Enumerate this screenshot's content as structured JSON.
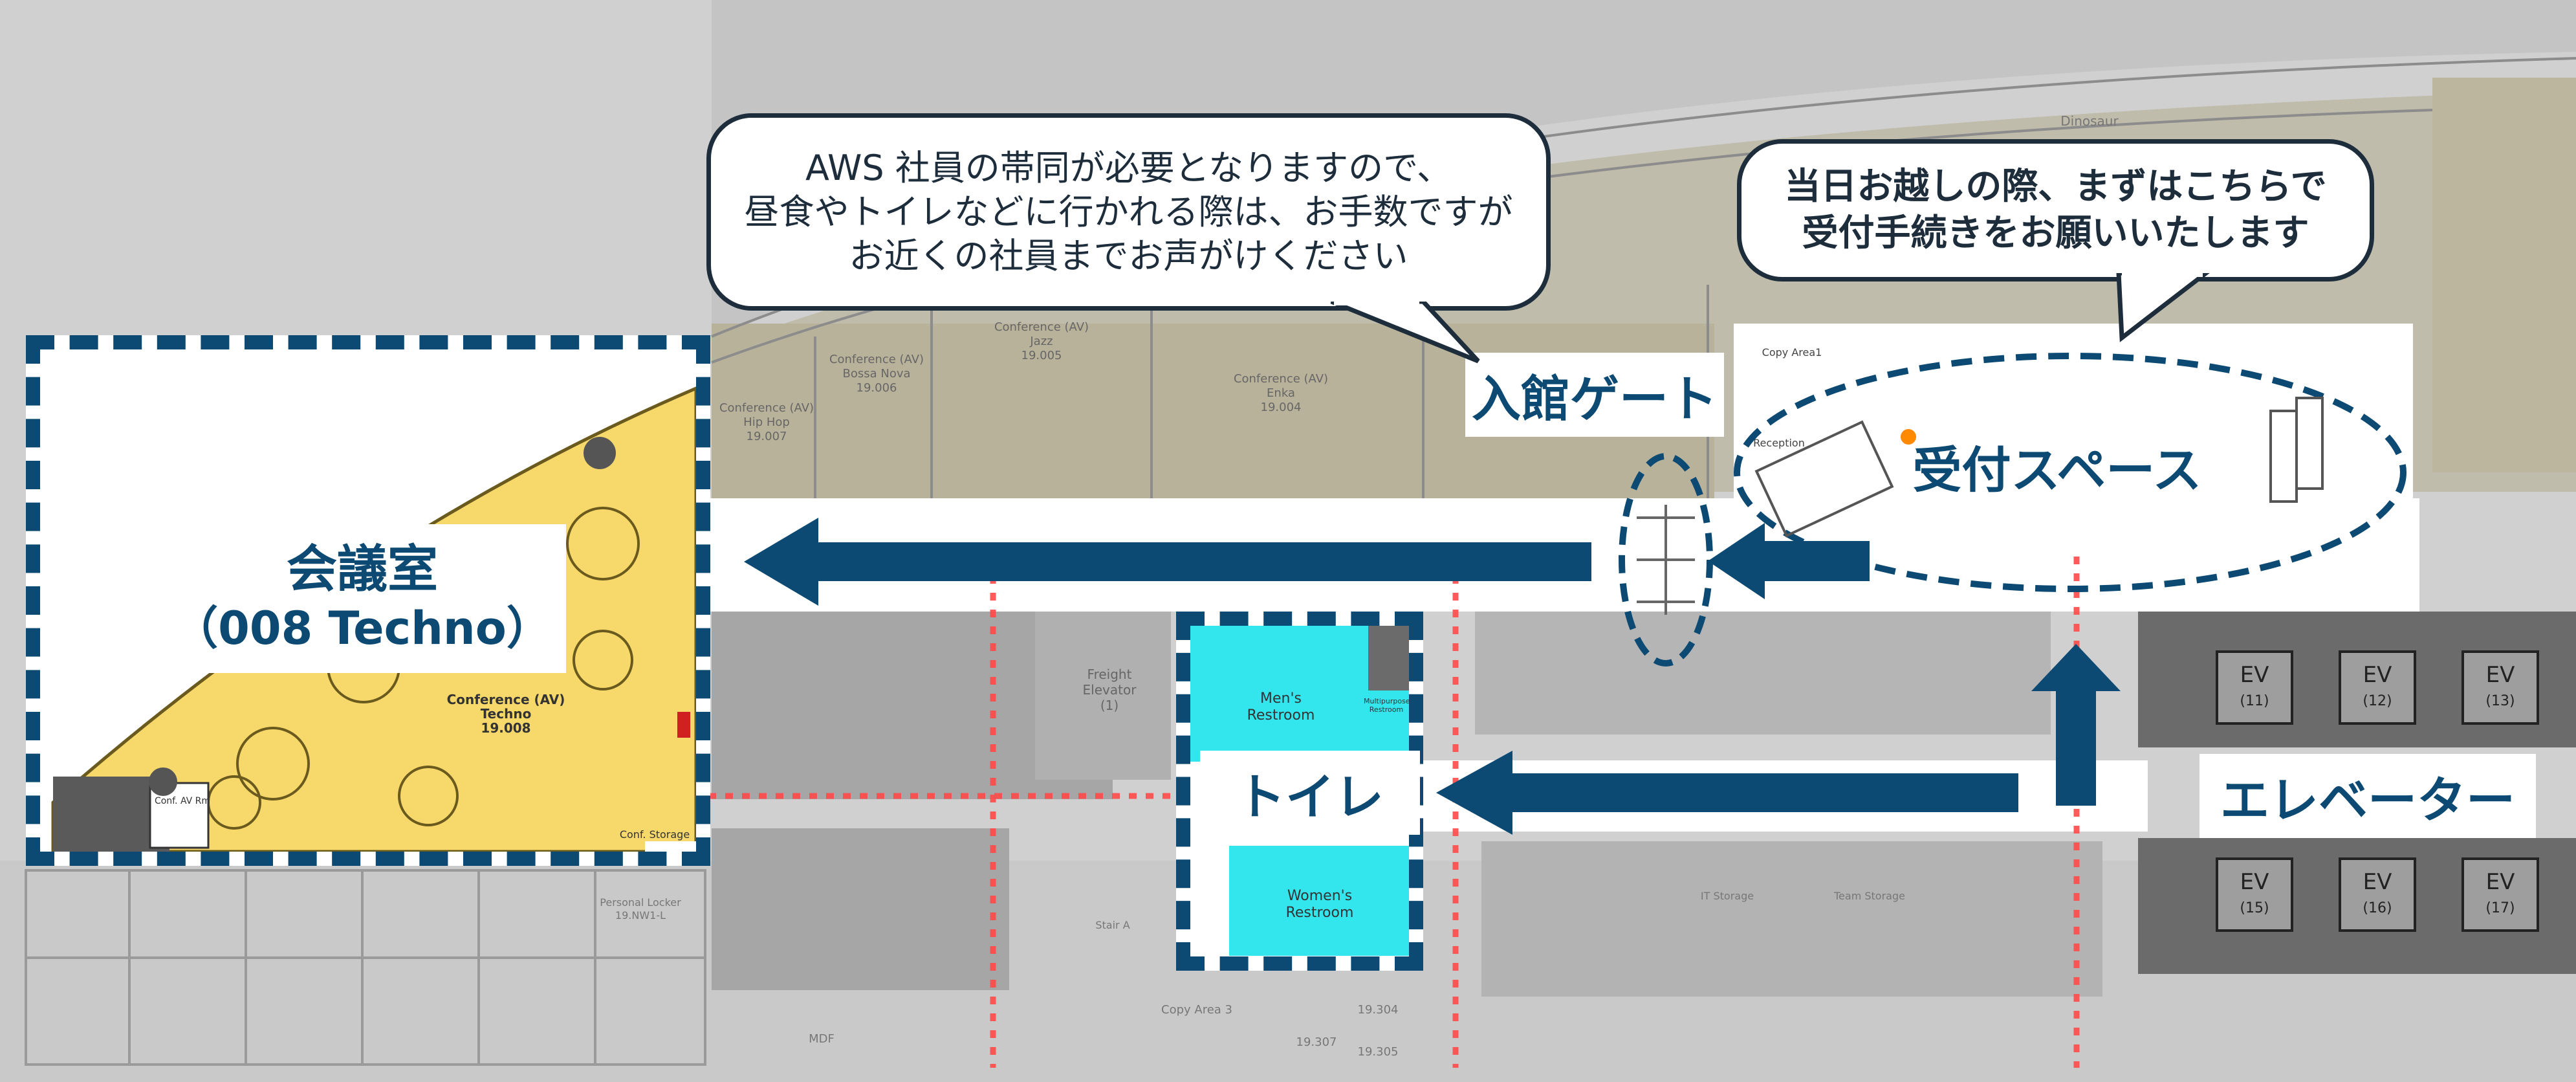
{
  "callouts": {
    "escort_note": "AWS 社員の帯同が必要となりますので、\n昼食やトイレなどに行かれる際は、お手数ですが\nお近くの社員までお声がけください",
    "reception_note": "当日お越しの際、まずはこちらで\n受付手続きをお願いいたします"
  },
  "areas": {
    "meeting_room_title": "会議室",
    "meeting_room_sub": "（008 Techno）",
    "entrance_gate": "入館ゲート",
    "reception_space": "受付スペース",
    "toilet": "トイレ",
    "elevator": "エレベーター"
  },
  "plan_labels": {
    "conf_techno": "Conference (AV)\nTechno\n19.008",
    "conf_hiphop": "Conference (AV)\nHip Hop\n19.007",
    "conf_bossa": "Conference (AV)\nBossa Nova\n19.006",
    "conf_jazz": "Conference (AV)\nJazz\n19.005",
    "conf_enka": "Conference (AV)\nEnka\n19.004",
    "mens_restroom": "Men's\nRestroom",
    "womens_restroom": "Women's\nRestroom",
    "multipurpose_restroom": "Multipurpose\nRestroom",
    "freight_elevator": "Freight\nElevator\n(1)",
    "conf_av_rm": "Conf. AV Rm",
    "conf_storage": "Conf. Storage",
    "reception": "Reception",
    "copy_area": "Copy Area1",
    "dinosaur": "Dinosaur",
    "personal_locker": "Personal Locker\n19.NW1-L",
    "mdf": "MDF",
    "copy_area_3": "Copy Area 3",
    "stair": "Stair A",
    "it_storage": "IT Storage",
    "team_storage": "Team Storage",
    "room_19_304": "19.304",
    "room_19_305": "19.305",
    "room_19_307": "19.307"
  },
  "elevators": [
    {
      "label": "EV",
      "num": "(11)"
    },
    {
      "label": "EV",
      "num": "(12)"
    },
    {
      "label": "EV",
      "num": "(13)"
    },
    {
      "label": "EV",
      "num": "(15)"
    },
    {
      "label": "EV",
      "num": "(16)"
    },
    {
      "label": "EV",
      "num": "(17)"
    }
  ],
  "colors": {
    "navy": "#0d4a73",
    "callout_border": "#1e2d3b",
    "meeting_yellow": "#f7d96b",
    "restroom_cyan": "#33e6ee",
    "route_red": "#ff4a4a",
    "corridor_white": "#ffffff"
  }
}
